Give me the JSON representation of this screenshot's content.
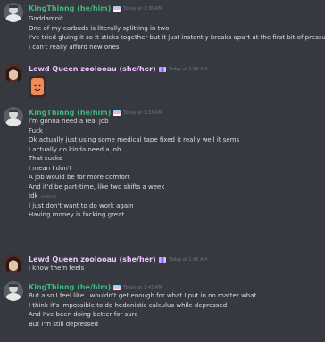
{
  "messages": [
    {
      "username": "KingThinng (he/him)",
      "timestamp": "Today at 1:30 AM",
      "lines": [
        "Goddamnit",
        "One of my earbuds is literally splitting in two",
        "I've tried gluing it so it sticks together but it just instantly breaks apart at the first bit of pressure",
        "I can't really afford new ones"
      ]
    },
    {
      "username": "Lewd Queen zoolooau (she/her)",
      "timestamp": "Today at 1:33 AM",
      "attachment": "emoji sticker"
    },
    {
      "username": "KingThinng (he/him)",
      "timestamp": "Today at 1:33 AM",
      "lines": [
        "I'm gonna need a real job",
        "Fuck",
        "Ok actually just using some medical tape fixed it really well it sems",
        "I actually do kinda need a job",
        "That sucks",
        "I mean I don't",
        "A job would be for more comfort",
        "And it'd be part-time, like two shifts a week",
        "Idk",
        "I just don't want to do work again",
        "Having money is fucking great"
      ],
      "edited_label": "(edited)"
    },
    {
      "username": "Lewd Queen zoolooau (she/her)",
      "timestamp": "Today at 1:42 AM",
      "lines": [
        "i know them feels"
      ]
    },
    {
      "username": "KingThinng (he/him)",
      "timestamp": "Today at 1:43 AM",
      "lines": [
        "But also I feel like I wouldn't get enough for what I put in no matter what",
        "I think it's impossible to do hedonistic calculus while depressed",
        "And I've been doing better for sure",
        "But I'm still depressed"
      ]
    }
  ],
  "colors": {
    "background": "#36393f",
    "username_king": "#43b581",
    "username_queen": "#eec3ff",
    "text": "#dcddde",
    "timestamp": "#72767d"
  }
}
